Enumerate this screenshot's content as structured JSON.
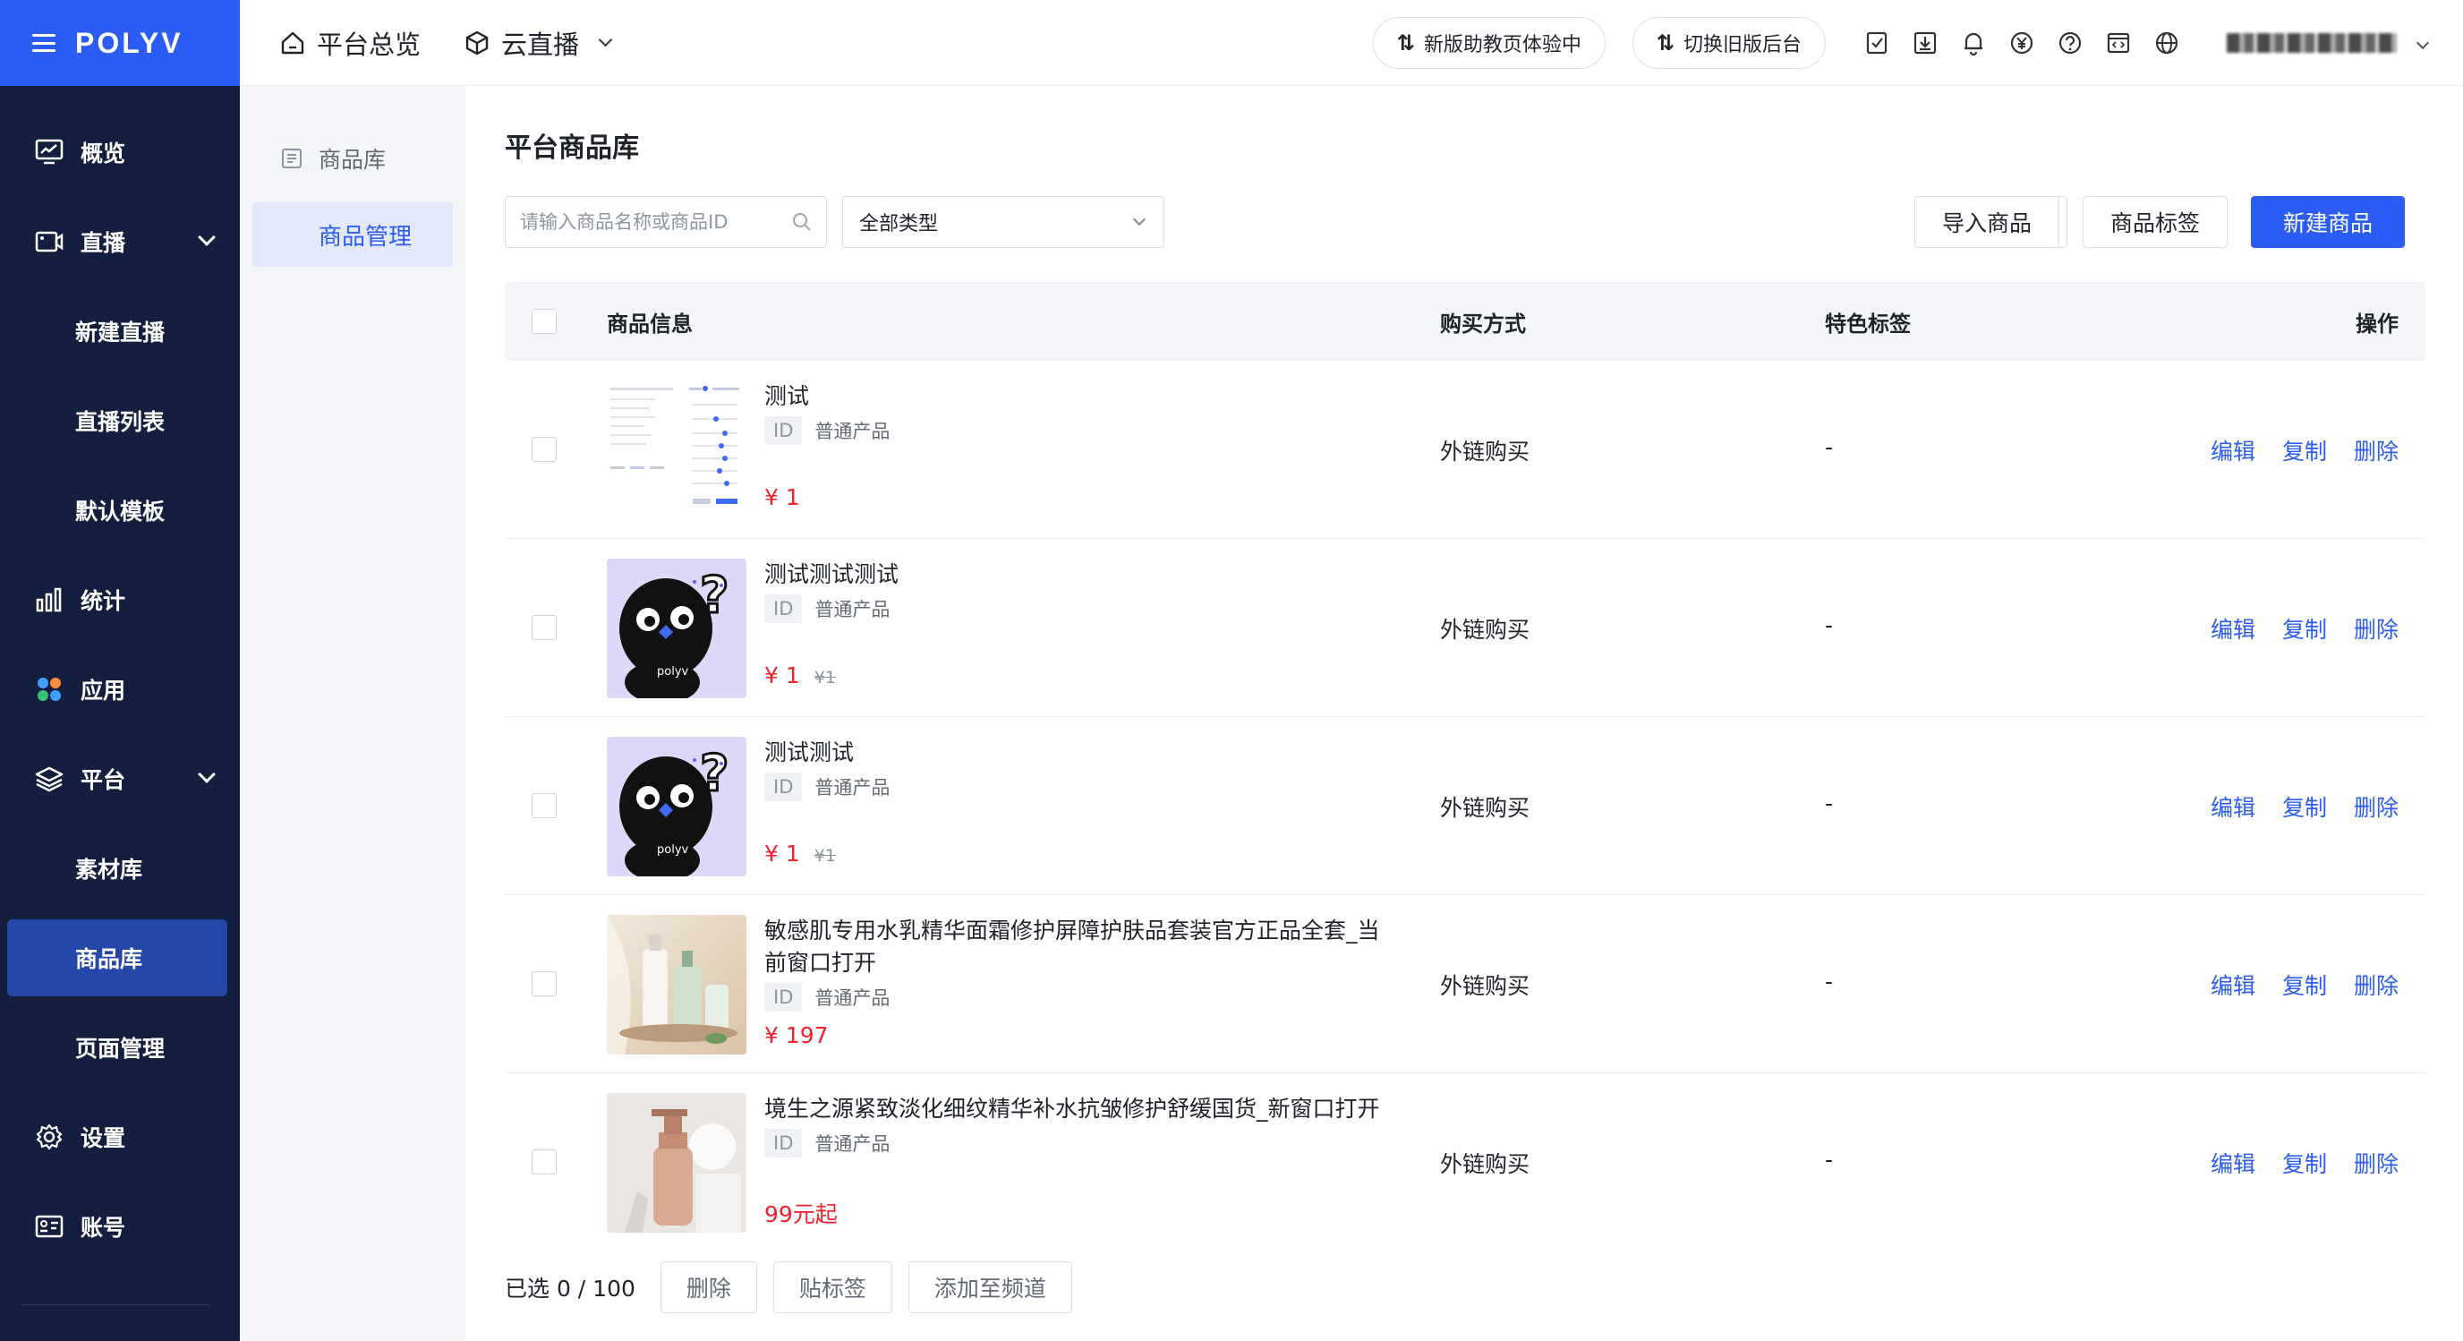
{
  "brand": {
    "logo": "POLYV"
  },
  "sidebar": {
    "items": [
      {
        "label": "概览",
        "icon": "monitor-icon"
      },
      {
        "label": "直播",
        "icon": "video-icon",
        "expandable": true
      },
      {
        "label": "新建直播",
        "sub": true
      },
      {
        "label": "直播列表",
        "sub": true
      },
      {
        "label": "默认模板",
        "sub": true
      },
      {
        "label": "统计",
        "icon": "bar-chart-icon"
      },
      {
        "label": "应用",
        "icon": "apps-icon"
      },
      {
        "label": "平台",
        "icon": "layers-icon",
        "expandable": true
      },
      {
        "label": "素材库",
        "sub": true
      },
      {
        "label": "商品库",
        "sub": true,
        "active": true
      },
      {
        "label": "页面管理",
        "sub": true
      },
      {
        "label": "设置",
        "icon": "gear-icon"
      },
      {
        "label": "账号",
        "icon": "id-card-icon"
      }
    ]
  },
  "header": {
    "crumb_home": "平台总览",
    "crumb_product": "云直播",
    "pill_new": "新版助教页体验中",
    "pill_old": "切换旧版后台"
  },
  "submenu": {
    "group_label": "商品库",
    "active_leaf": "商品管理"
  },
  "main": {
    "title": "平台商品库",
    "search_placeholder": "请输入商品名称或商品ID",
    "type_select": "全部类型",
    "btn_import": "导入商品",
    "btn_tags": "商品标签",
    "btn_new": "新建商品",
    "columns": {
      "info": "商品信息",
      "buy": "购买方式",
      "tag": "特色标签",
      "op": "操作"
    },
    "rows": [
      {
        "name": "测试",
        "id_tag": "ID",
        "type": "普通产品",
        "price": "¥ 1",
        "orig": "",
        "buy": "外链购买",
        "tag": "-",
        "thumb": "screenshot"
      },
      {
        "name": "测试测试测试",
        "id_tag": "ID",
        "type": "普通产品",
        "price": "¥ 1",
        "orig": "¥1",
        "buy": "外链购买",
        "tag": "-",
        "thumb": "mascot"
      },
      {
        "name": "测试测试",
        "id_tag": "ID",
        "type": "普通产品",
        "price": "¥ 1",
        "orig": "¥1",
        "buy": "外链购买",
        "tag": "-",
        "thumb": "mascot"
      },
      {
        "name": "敏感肌专用水乳精华面霜修护屏障护肤品套装官方正品全套_当前窗口打开",
        "id_tag": "ID",
        "type": "普通产品",
        "price": "¥ 197",
        "orig": "",
        "buy": "外链购买",
        "tag": "-",
        "thumb": "cosmetics"
      },
      {
        "name": "境生之源紧致淡化细纹精华补水抗皱修护舒缓国货_新窗口打开",
        "id_tag": "ID",
        "type": "普通产品",
        "price": "99元起",
        "orig": "",
        "buy": "外链购买",
        "tag": "-",
        "thumb": "bottle"
      }
    ],
    "ops": {
      "edit": "编辑",
      "copy": "复制",
      "delete": "删除"
    },
    "footer": {
      "selected": "已选 0 / 100",
      "delete": "删除",
      "tag": "贴标签",
      "add_channel": "添加至频道"
    }
  },
  "colors": {
    "primary": "#2c5cf6",
    "sidebar": "#141f3f",
    "price": "#f5222d"
  }
}
